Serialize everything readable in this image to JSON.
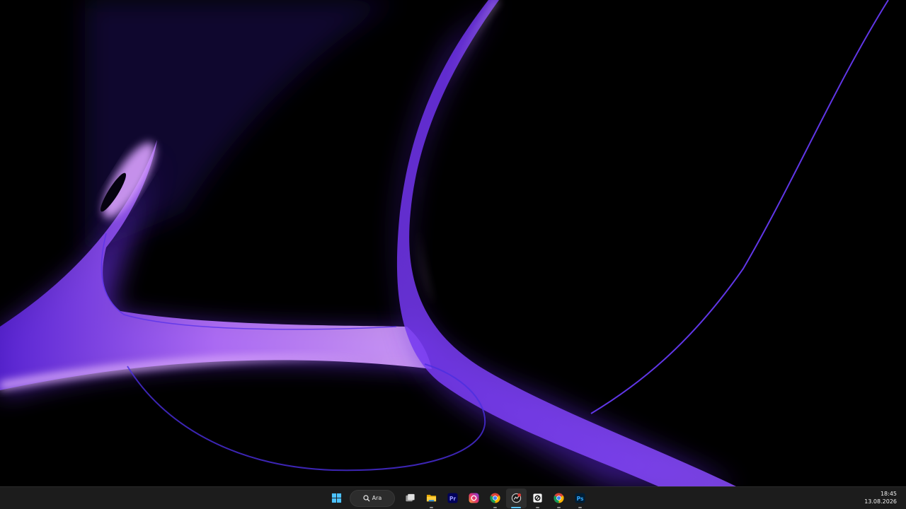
{
  "desktop": {
    "wallpaper": "abstract-purple-light-ribbons",
    "colors": {
      "background": "#000000",
      "ribbon_bright": "#c98cff",
      "ribbon_mid": "#7a3cf0",
      "ribbon_deep": "#3a1a9a"
    }
  },
  "taskbar": {
    "background": "#1c1c1c",
    "search": {
      "label": "Ara",
      "icon": "search-icon"
    },
    "items": [
      {
        "name": "start-button",
        "icon": "windows-logo-icon"
      },
      {
        "name": "task-view-button",
        "icon": "task-view-icon"
      },
      {
        "name": "file-explorer-button",
        "icon": "folder-icon"
      },
      {
        "name": "premiere-pro-button",
        "icon": "premiere-pro-icon",
        "text": "Pr"
      },
      {
        "name": "app-button",
        "icon": "app-icon"
      },
      {
        "name": "chrome-button",
        "icon": "chrome-icon"
      },
      {
        "name": "active-app-button",
        "icon": "active-app-icon",
        "active": true
      },
      {
        "name": "notes-app-button",
        "icon": "notes-app-icon"
      },
      {
        "name": "chrome-profile-button",
        "icon": "chrome-icon"
      },
      {
        "name": "photoshop-button",
        "icon": "photoshop-icon",
        "text": "Ps"
      }
    ],
    "clock": {
      "time": "18:45",
      "date": "13.08.2026"
    }
  }
}
